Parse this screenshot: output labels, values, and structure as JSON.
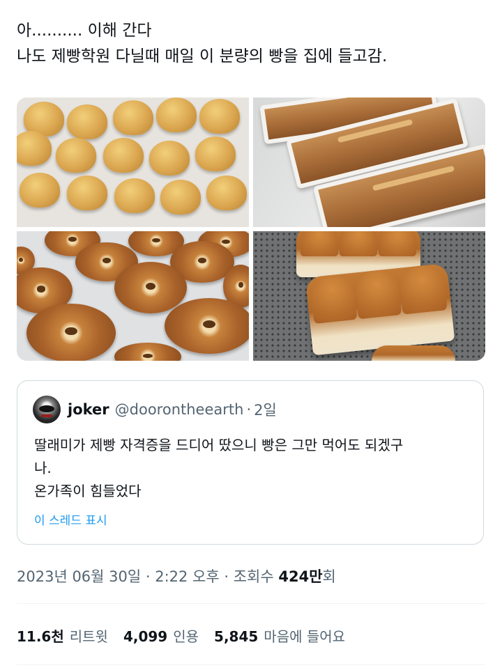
{
  "tweet": {
    "line1": "아.......... 이해 간다",
    "line2": "나도 제빵학원 다닐때 매일 이 분량의 빵을 집에 들고감."
  },
  "quoted": {
    "name": "joker",
    "handle": "@doorontheearth",
    "separator": "·",
    "time": "2일",
    "body_line1": "딸래미가 제빵 자격증을 드디어 땄으니 빵은 그만 먹어도 되겠구",
    "body_line2": "나.",
    "body_line3": "온가족이 힘들었다",
    "show_thread": "이 스레드 표시"
  },
  "meta": {
    "datetime": "2023년 06월 30일 · 2:22 오후 · 조회수 ",
    "views_number": "424만",
    "views_suffix": "회"
  },
  "stats": {
    "retweets_count": "11.6천",
    "retweets_label": "리트윗",
    "quotes_count": "4,099",
    "quotes_label": "인용",
    "likes_count": "5,845",
    "likes_label": "마음에 들어요"
  },
  "colors": {
    "link": "#1d9bf0",
    "secondary": "#536471",
    "border": "#cfd9de"
  }
}
